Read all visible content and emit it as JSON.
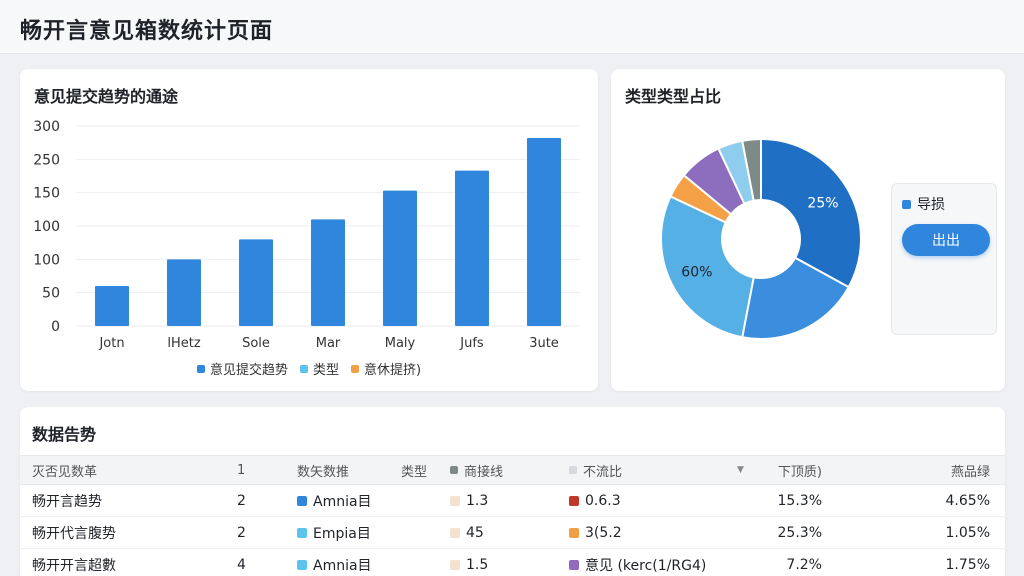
{
  "page": {
    "title": "畅开言意见箱数统计页面"
  },
  "colors": {
    "primary": "#2f86dc",
    "light_blue": "#5cc2ee",
    "orange": "#f0a046"
  },
  "bar_card": {
    "title": "意见提交趋势的通途"
  },
  "pie_card": {
    "title": "类型类型占比",
    "panel_item": "导损",
    "button_label": "出出"
  },
  "table": {
    "title": "数据告势",
    "headers": [
      "灭否见数革",
      "1",
      "数矢数推",
      "类型",
      "商接线",
      "不流比",
      "下顶质)",
      "燕品绿"
    ],
    "rows": [
      {
        "name": "畅开言趋势",
        "num": "2",
        "type": "Amnia目",
        "type_color": "#2f86dc",
        "v1": "1.3",
        "v1_color": "#f6e1cf",
        "v2": "0.6.3",
        "v2_color": "#c0392b",
        "p1": "15.3%",
        "p2": "4.65%"
      },
      {
        "name": "畅开代言腹势",
        "num": "2",
        "type": "Empia目",
        "type_color": "#5cc2ee",
        "v1": "45",
        "v1_color": "#f6e1cf",
        "v2": "3(5.2",
        "v2_color": "#f0a046",
        "p1": "25.3%",
        "p2": "1.05%"
      },
      {
        "name": "畅开开言超數",
        "num": "4",
        "type": "Amnia目",
        "type_color": "#5cc2ee",
        "v1": "1.5",
        "v1_color": "#f6e1cf",
        "v2": "意见 (kerc(1/RG4)",
        "v2_color": "#8e6bbf",
        "p1": "7.2%",
        "p2": "1.75%"
      }
    ]
  },
  "chart_data": [
    {
      "type": "bar",
      "title": "意见提交趋势的通途",
      "categories": [
        "Jotn",
        "lHetz",
        "Sole",
        "Mar",
        "Maly",
        "Jufs",
        "3ute"
      ],
      "values": [
        60,
        100,
        130,
        160,
        203,
        233,
        282
      ],
      "y_tick_labels": [
        "0",
        "50",
        "100",
        "100",
        "150",
        "250",
        "300"
      ],
      "ylim": [
        0,
        300
      ],
      "grid": true,
      "legend": [
        {
          "name": "意见提交趋势",
          "color": "#2f86dc"
        },
        {
          "name": "类型",
          "color": "#5cc2ee"
        },
        {
          "name": "意休提挤)",
          "color": "#f0a046"
        }
      ],
      "legend_position": "bottom",
      "bar_color": "#2f86dc"
    },
    {
      "type": "pie",
      "title": "类型类型占比",
      "donut": true,
      "slices": [
        {
          "value": 33,
          "color": "#1f6fc4",
          "label": "25%"
        },
        {
          "value": 20,
          "color": "#3b8ede",
          "label": ""
        },
        {
          "value": 29,
          "color": "#55b0e6",
          "label": "60%"
        },
        {
          "value": 4,
          "color": "#f3a047",
          "label": ""
        },
        {
          "value": 7,
          "color": "#8d6dbd",
          "label": ""
        },
        {
          "value": 4,
          "color": "#8fcdee",
          "label": ""
        },
        {
          "value": 3,
          "color": "#7d8a86",
          "label": ""
        }
      ]
    }
  ]
}
